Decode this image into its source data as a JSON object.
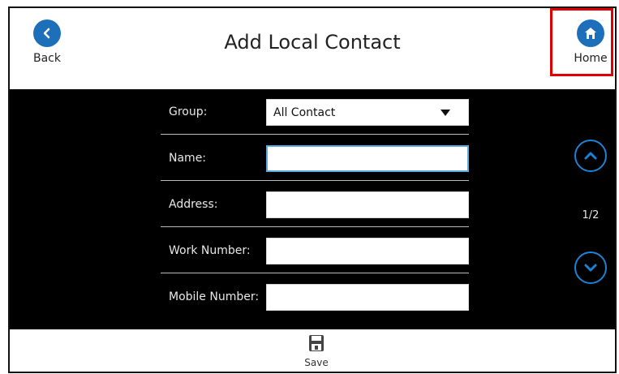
{
  "header": {
    "title": "Add Local Contact",
    "back_label": "Back",
    "home_label": "Home"
  },
  "form": {
    "group_label": "Group:",
    "group_value": "All Contact",
    "name_label": "Name:",
    "name_value": "",
    "address_label": "Address:",
    "address_value": "",
    "work_label": "Work Number:",
    "work_value": "",
    "mobile_label": "Mobile Number:",
    "mobile_value": ""
  },
  "pager": {
    "indicator": "1/2"
  },
  "footer": {
    "save_label": "Save"
  },
  "colors": {
    "accent": "#1c6fb8",
    "highlight": "#e00000",
    "content_bg": "#000000"
  }
}
